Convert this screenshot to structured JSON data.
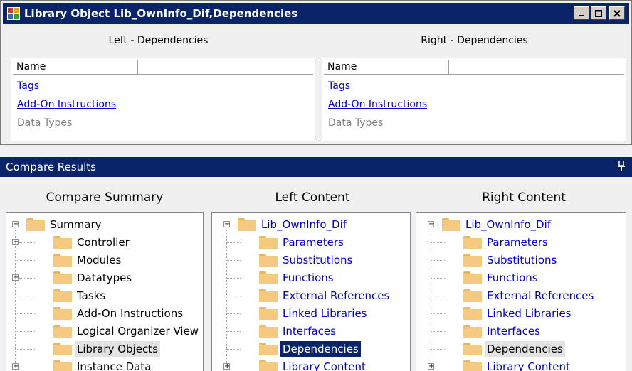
{
  "window": {
    "title": "Library Object Lib_OwnInfo_Dif,Dependencies",
    "buttons": [
      "minimize",
      "maximize",
      "close"
    ]
  },
  "left_panel": {
    "title": "Left - Dependencies",
    "column": "Name",
    "rows": [
      {
        "label": "Tags",
        "link": true
      },
      {
        "label": "Add-On Instructions",
        "link": true
      },
      {
        "label": "Data Types",
        "link": false
      }
    ]
  },
  "right_panel": {
    "title": "Right - Dependencies",
    "column": "Name",
    "rows": [
      {
        "label": "Tags",
        "link": true
      },
      {
        "label": "Add-On Instructions",
        "link": true
      },
      {
        "label": "Data Types",
        "link": false
      }
    ]
  },
  "compare_results": {
    "title": "Compare Results",
    "pin_icon": "pin-icon"
  },
  "summary_pane": {
    "heading": "Compare Summary",
    "items": [
      "Summary",
      "Controller",
      "Modules",
      "Datatypes",
      "Tasks",
      "Add-On Instructions",
      "Logical Organizer View",
      "Library Objects",
      "Instance Data"
    ]
  },
  "left_content": {
    "heading": "Left Content",
    "items": [
      "Lib_OwnInfo_Dif",
      "Parameters",
      "Substitutions",
      "Functions",
      "External References",
      "Linked Libraries",
      "Interfaces",
      "Dependencies",
      "Library Content"
    ]
  },
  "right_content": {
    "heading": "Right Content",
    "items": [
      "Lib_OwnInfo_Dif",
      "Parameters",
      "Substitutions",
      "Functions",
      "External References",
      "Linked Libraries",
      "Interfaces",
      "Dependencies",
      "Library Content"
    ]
  },
  "colors": {
    "titlebar": "#0a246a",
    "link": "#0000cc",
    "folder": "#f6c980"
  }
}
